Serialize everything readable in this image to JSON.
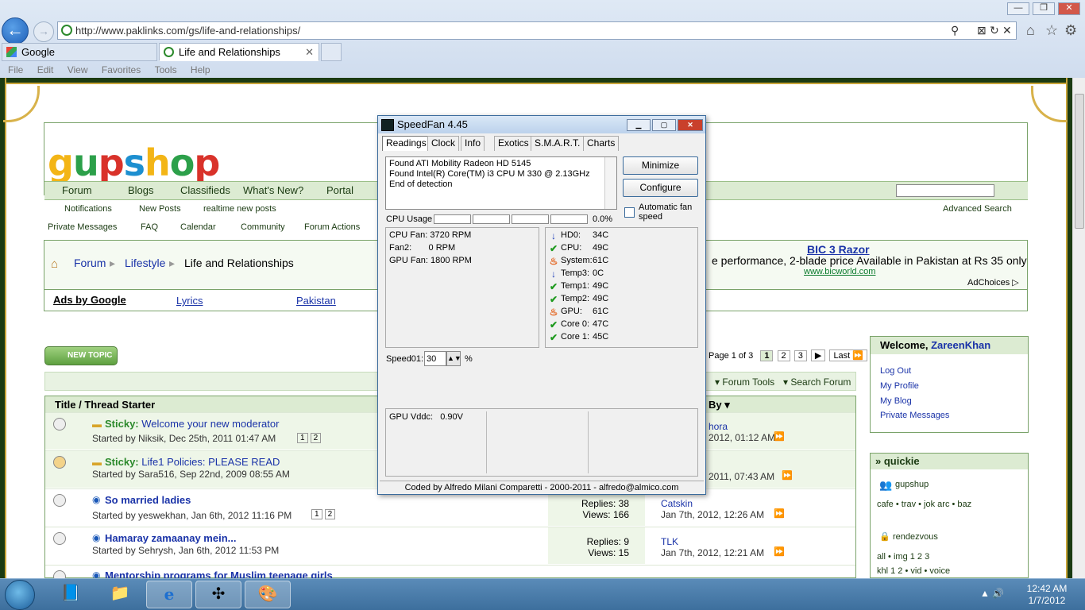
{
  "browser": {
    "url": "http://www.paklinks.com/gs/life-and-relationships/",
    "tabs": [
      "Google",
      "Life and Relationships"
    ],
    "menu": [
      "File",
      "Edit",
      "View",
      "Favorites",
      "Tools",
      "Help"
    ]
  },
  "site": {
    "logo": "gupshup",
    "nav": [
      "Forum",
      "Blogs",
      "Classifieds",
      "What's New?",
      "Portal"
    ],
    "subnav1": [
      "Notifications",
      "New Posts",
      "realtime new posts"
    ],
    "subnav2": [
      "Private Messages",
      "FAQ",
      "Calendar",
      "Community",
      "Forum Actions"
    ],
    "advanced_search": "Advanced Search",
    "breadcrumb": [
      "Forum",
      "Lifestyle",
      "Life and Relationships"
    ],
    "ad": {
      "title": "BIC 3 Razor",
      "text": "e performance, 2-blade price Available in Pakistan at Rs 35 only",
      "url": "www.bicworld.com",
      "adchoices": "AdChoices"
    },
    "ads_by_google": "Ads by Google",
    "ads_links": [
      "Lyrics",
      "Pakistan"
    ],
    "new_topic": "NEW TOPIC",
    "pagination": {
      "label": "Page 1 of 3",
      "pages": [
        "1",
        "2",
        "3"
      ],
      "last": "Last"
    },
    "tools": [
      "Forum Tools",
      "Search Forum"
    ],
    "thread_header": {
      "title": "Title / Thread Starter",
      "by": "By"
    },
    "threads": [
      {
        "sticky": "Sticky:",
        "title": "Welcome your new moderator",
        "by": "Started by Niksik, Dec 25th, 2011 01:47 AM",
        "pages": [
          "1",
          "2"
        ],
        "last_user": "hora",
        "last_time": "2012, 01:12 AM"
      },
      {
        "sticky": "Sticky:",
        "title": "Life1 Policies: PLEASE READ",
        "by": "Started by Sara516, Sep 22nd, 2009 08:55 AM",
        "pages": [],
        "last_user": "",
        "last_time": "2011, 07:43 AM"
      },
      {
        "sticky": "",
        "title": "So married ladies",
        "by": "Started by yeswekhan, Jan 6th, 2012 11:16 PM",
        "pages": [
          "1",
          "2"
        ],
        "replies": "Replies: 38",
        "views": "Views: 166",
        "last_user": "Catskin",
        "last_time": "Jan 7th, 2012, 12:26 AM"
      },
      {
        "sticky": "",
        "title": "Hamaray zamaanay mein...",
        "by": "Started by Sehrysh, Jan 6th, 2012 11:53 PM",
        "pages": [],
        "replies": "Replies: 9",
        "views": "Views: 15",
        "last_user": "TLK",
        "last_time": "Jan 7th, 2012, 12:21 AM"
      },
      {
        "sticky": "",
        "title": "Mentorship programs for Muslim teenage girls",
        "by": "",
        "pages": [],
        "last_user": "",
        "last_time": ""
      }
    ],
    "welcome": {
      "label": "Welcome,",
      "user": "ZareenKhan",
      "links": [
        "Log Out",
        "My Profile",
        "My Blog",
        "Private Messages"
      ]
    },
    "quickie": {
      "title": "» quickie",
      "gupshup": "gupshup",
      "links1": "cafe • trav • jok arc • baz",
      "rendezvous": "rendezvous",
      "links2": "all • img 1 2 3",
      "links3": "khl 1 2 • vid • voice"
    }
  },
  "speedfan": {
    "title": "SpeedFan 4.45",
    "tabs": [
      "Readings",
      "Clock",
      "Info",
      "Exotics",
      "S.M.A.R.T.",
      "Charts"
    ],
    "log": [
      "Found ATI Mobility Radeon HD 5145",
      "Found Intel(R) Core(TM) i3 CPU M 330 @ 2.13GHz",
      "End of detection"
    ],
    "minimize": "Minimize",
    "configure": "Configure",
    "auto_fan": "Automatic fan speed",
    "cpu_usage": "CPU Usage",
    "cpu_pct": "0.0%",
    "fans": [
      "CPU Fan: 3720 RPM",
      "Fan2:       0 RPM",
      "GPU Fan: 1800 RPM"
    ],
    "temps": [
      {
        "icon": "down-arrow",
        "label": "HD0:",
        "value": "34C"
      },
      {
        "icon": "check",
        "label": "CPU:",
        "value": "49C"
      },
      {
        "icon": "flame",
        "label": "System:",
        "value": "61C"
      },
      {
        "icon": "down-arrow",
        "label": "Temp3:",
        "value": "0C"
      },
      {
        "icon": "check",
        "label": "Temp1:",
        "value": "49C"
      },
      {
        "icon": "check",
        "label": "Temp2:",
        "value": "49C"
      },
      {
        "icon": "flame",
        "label": "GPU:",
        "value": "61C"
      },
      {
        "icon": "check",
        "label": "Core 0:",
        "value": "47C"
      },
      {
        "icon": "check",
        "label": "Core 1:",
        "value": "45C"
      }
    ],
    "speed_label": "Speed01:",
    "speed_value": "30",
    "speed_unit": "%",
    "voltage": "GPU Vddc:   0.90V",
    "status": "Coded by Alfredo Milani Comparetti - 2000-2011 - alfredo@almico.com"
  },
  "taskbar": {
    "time": "12:42 AM",
    "date": "1/7/2012"
  }
}
